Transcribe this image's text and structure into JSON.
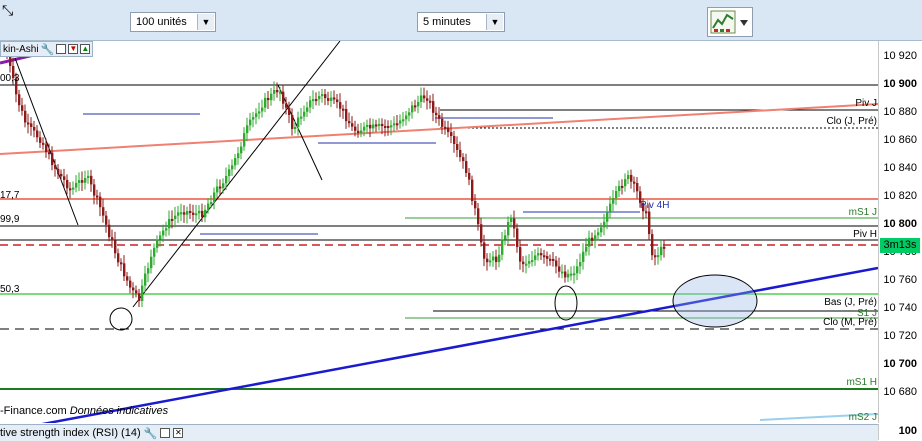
{
  "toolbar": {
    "units_dropdown": "100 unités",
    "interval_dropdown": "5 minutes",
    "corner_icon": "resize-icon",
    "tool_button_icon": "chart-tools-icon"
  },
  "chart_header": {
    "title": "kin-Ashi"
  },
  "price_axis": {
    "ticks": [
      "10 920",
      "10 900",
      "10 880",
      "10 860",
      "10 840",
      "10 820",
      "10 800",
      "10 780",
      "10 760",
      "10 740",
      "10 720",
      "10 700",
      "10 680",
      "100"
    ],
    "countdown": "3m13s"
  },
  "left_labels": [
    "00,3",
    "17,7",
    "99,9",
    "50,3"
  ],
  "right_labels": {
    "piv_j": "Piv J",
    "clo_j_pre": "Clo (J, Pré)",
    "piv_4h": "Piv 4H",
    "ms1_j": "mS1 J",
    "piv_h": "Piv H",
    "bas_j_pre": "Bas (J, Pré)",
    "s1_j": "S1 J",
    "clo_m_pre": "Clo (M, Pré)",
    "ms1_h": "mS1 H",
    "ms2_j": "mS2 J"
  },
  "footer": {
    "source": "-Finance.com",
    "note": "Données indicatives"
  },
  "rsi_panel": {
    "title": "tive strength index (RSI) (14)"
  },
  "colors": {
    "bull": "#2eaa2e",
    "bear": "#8b1a1a",
    "trend_blue": "#1a1ad0",
    "salmon": "#f08070",
    "green_line": "#3a9a3a",
    "light_green": "#7cdc7c",
    "dashed_red": "#cc2222"
  }
}
